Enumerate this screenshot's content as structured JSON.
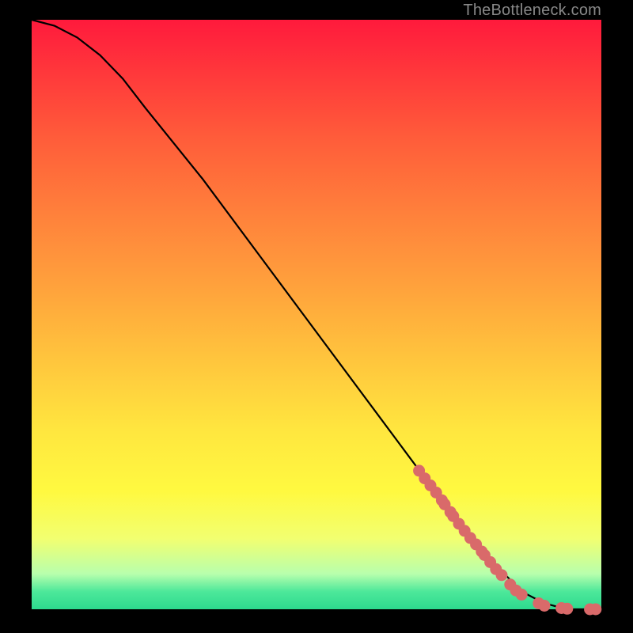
{
  "watermark": "TheBottleneck.com",
  "chart_data": {
    "type": "line",
    "title": "",
    "xlabel": "",
    "ylabel": "",
    "xlim": [
      0,
      100
    ],
    "ylim": [
      0,
      100
    ],
    "grid": false,
    "legend": false,
    "colors": {
      "gradient_top": "#ff1a3c",
      "gradient_mid": "#ffe73f",
      "gradient_bottom": "#2dd98e",
      "curve": "#000000",
      "markers": "#d96a6a"
    },
    "series": [
      {
        "name": "curve",
        "x": [
          0,
          4,
          8,
          12,
          16,
          20,
          30,
          40,
          50,
          60,
          70,
          78,
          82,
          86,
          90,
          94,
          98,
          100
        ],
        "y": [
          100,
          99,
          97,
          94,
          90,
          85,
          73,
          60,
          47,
          34,
          21,
          11,
          7,
          3,
          1,
          0,
          0,
          0
        ]
      },
      {
        "name": "markers",
        "x": [
          68,
          69,
          70,
          71,
          72,
          72.5,
          73.5,
          74,
          75,
          76,
          77,
          78,
          79,
          79.5,
          80.5,
          81.5,
          82.5,
          84,
          85,
          86,
          89,
          90,
          93,
          94,
          98,
          99
        ],
        "y": [
          23.5,
          22.2,
          21,
          19.8,
          18.5,
          17.8,
          16.5,
          15.8,
          14.5,
          13.3,
          12.1,
          11,
          9.8,
          9.2,
          8,
          6.8,
          5.8,
          4.2,
          3.2,
          2.5,
          1,
          0.6,
          0.2,
          0.1,
          0,
          0
        ]
      }
    ]
  }
}
